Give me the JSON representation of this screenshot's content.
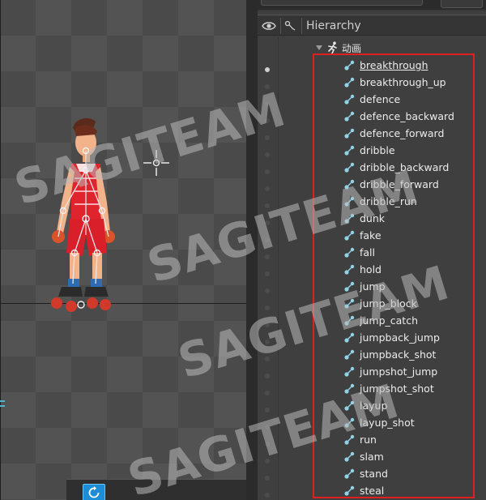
{
  "panel": {
    "title": "Hierarchy",
    "root": {
      "label": "动画",
      "items": [
        {
          "label": "breakthrough",
          "underline": true
        },
        {
          "label": "breakthrough_up"
        },
        {
          "label": "defence"
        },
        {
          "label": "defence_backward"
        },
        {
          "label": "defence_forward"
        },
        {
          "label": "dribble"
        },
        {
          "label": "dribble_backward"
        },
        {
          "label": "dribble_forward"
        },
        {
          "label": "dribble_run"
        },
        {
          "label": "dunk"
        },
        {
          "label": "fake"
        },
        {
          "label": "fall"
        },
        {
          "label": "hold"
        },
        {
          "label": "jump"
        },
        {
          "label": "jump_block"
        },
        {
          "label": "jump_catch"
        },
        {
          "label": "jumpback_jump"
        },
        {
          "label": "jumpback_shot"
        },
        {
          "label": "jumpshot_jump"
        },
        {
          "label": "jumpshot_shot"
        },
        {
          "label": "layup"
        },
        {
          "label": "layup_shot"
        },
        {
          "label": "run"
        },
        {
          "label": "slam"
        },
        {
          "label": "stand"
        },
        {
          "label": "steal"
        }
      ]
    }
  },
  "watermark": {
    "text": "SAGITEAM"
  },
  "icons": {
    "visibility": "eye-icon",
    "link": "link-icon",
    "root": "running-figure-icon",
    "item": "bone-node-icon",
    "toolbar": "refresh-icon",
    "viewport": "crosshair-icon"
  },
  "colors": {
    "highlight": "#e02020",
    "accent": "#1d8dd6",
    "node_icon": "#8fd3e8"
  }
}
